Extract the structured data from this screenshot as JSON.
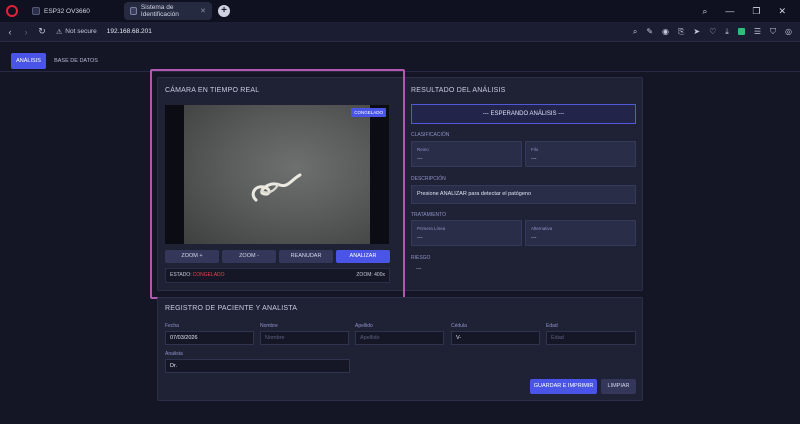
{
  "browser": {
    "tabs": [
      {
        "label": "ESP32 OV3660"
      },
      {
        "label": "Sistema de Identificación"
      }
    ],
    "address": {
      "security": "Not secure",
      "url": "192.168.68.201"
    }
  },
  "nav": {
    "tabs": [
      {
        "label": "ANÁLISIS"
      },
      {
        "label": "BASE DE DATOS"
      }
    ]
  },
  "camera": {
    "title": "CÁMARA EN TIEMPO REAL",
    "badge": "CONGELADO",
    "buttons": {
      "zoom_in": "ZOOM +",
      "zoom_out": "ZOOM -",
      "resume": "REANUDAR",
      "analyze": "ANALIZAR"
    },
    "status_label": "ESTADO:",
    "status_value": "CONGELADO",
    "zoom_text": "ZOOM: 400x"
  },
  "results": {
    "title": "RESULTADO DEL ANÁLISIS",
    "waiting": "--- ESPERANDO ANÁLISIS ---",
    "classification_label": "CLASIFICACIÓN",
    "reino": {
      "label": "Reino",
      "value": "---"
    },
    "filo": {
      "label": "Filo",
      "value": "---"
    },
    "description_label": "DESCRIPCIÓN",
    "description_text": "Presione ANALIZAR para detectar el patógeno",
    "treatment_label": "TRATAMIENTO",
    "primera": {
      "label": "Primera Línea",
      "value": "---"
    },
    "alternativa": {
      "label": "Alternativa",
      "value": "---"
    },
    "risk_label": "RIESGO",
    "risk_value": "---"
  },
  "form": {
    "title": "REGISTRO DE PACIENTE Y ANALISTA",
    "fecha": {
      "label": "Fecha",
      "value": "07/03/2026"
    },
    "nombre": {
      "label": "Nombre",
      "placeholder": "Nombre"
    },
    "apellido": {
      "label": "Apellido",
      "placeholder": "Apellido"
    },
    "cedula": {
      "label": "Cédula",
      "value": "V-"
    },
    "edad": {
      "label": "Edad",
      "placeholder": "Edad"
    },
    "analista": {
      "label": "Analista",
      "value": "Dr."
    },
    "save_label": "GUARDAR E IMPRIMIR",
    "clear_label": "LIMPIAR"
  },
  "colors": {
    "accent": "#4a55e8",
    "highlight_outline": "#b556b0",
    "status_red": "#e8424f",
    "badge_green": "#28c07a"
  },
  "icons": [
    "opera-icon",
    "back-icon",
    "forward-icon",
    "reload-icon",
    "warning-icon",
    "search-icon",
    "edit-icon",
    "camera-icon",
    "share-icon",
    "send-icon",
    "heart-icon",
    "download-icon",
    "wallet-icon",
    "menu-icon",
    "shield-icon",
    "ring-icon"
  ]
}
